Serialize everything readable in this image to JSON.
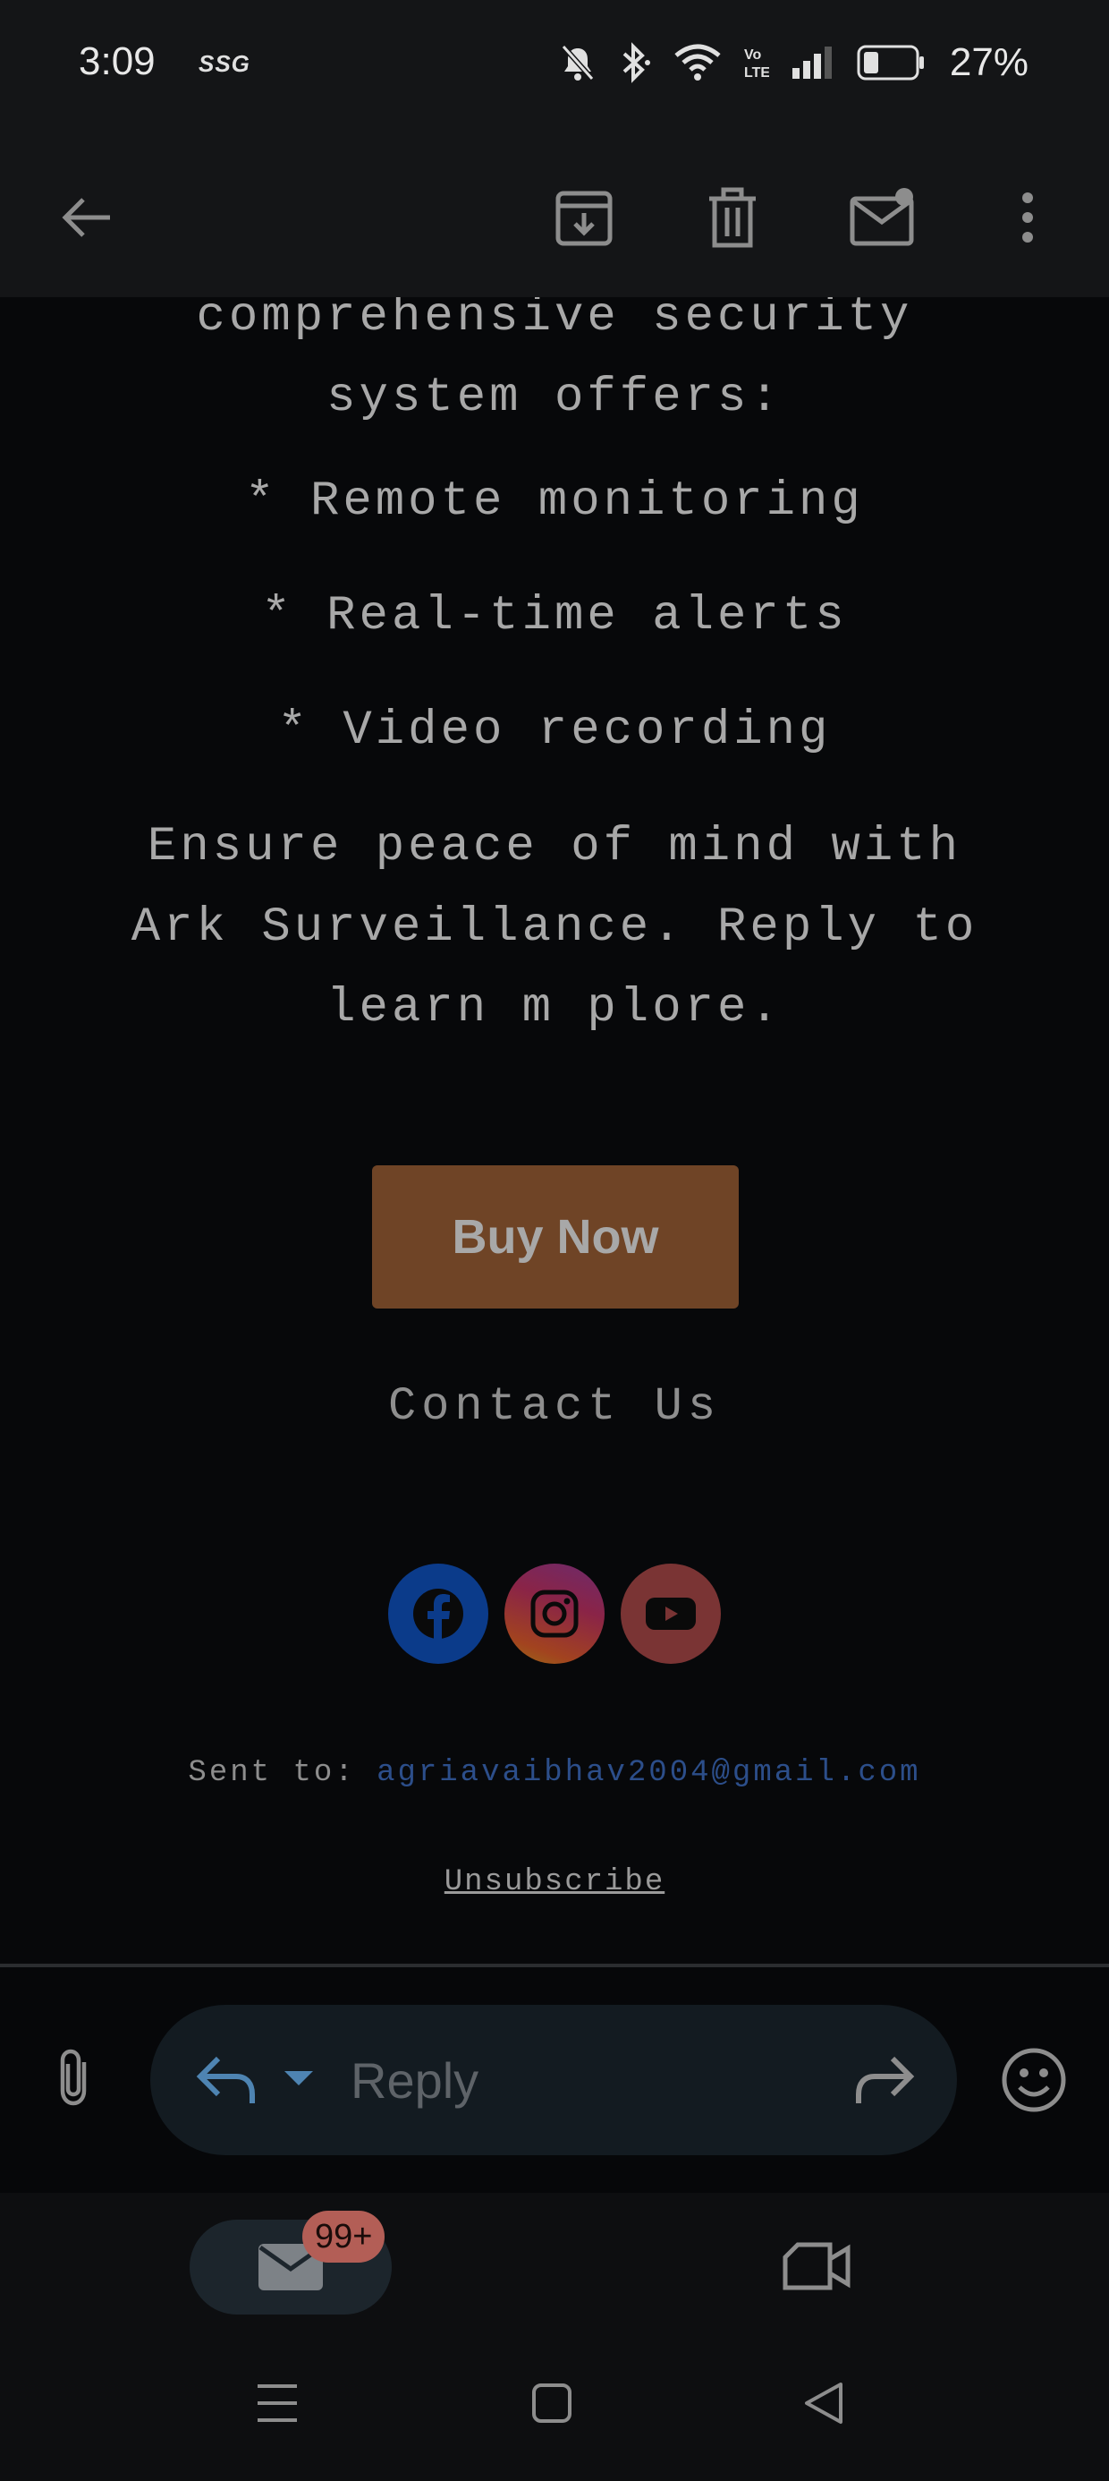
{
  "status_bar": {
    "time": "3:09",
    "carrier": "SSG",
    "battery": "27%"
  },
  "app_bar": {
    "icons": [
      "back-arrow-icon",
      "archive-icon",
      "trash-icon",
      "mark-unread-icon",
      "more-vert-icon"
    ]
  },
  "email": {
    "intro_lines": [
      "comprehensive security",
      "system offers:"
    ],
    "features": [
      "* Remote monitoring",
      "* Real-time alerts",
      "* Video recording"
    ],
    "closing_lines": [
      "Ensure peace of mind with",
      "Ark Surveillance. Reply to",
      "learn m plore."
    ],
    "buy_button": "Buy Now",
    "contact": "Contact Us",
    "social": [
      "facebook-icon",
      "instagram-icon",
      "youtube-icon"
    ],
    "sent_to_label": "Sent to:",
    "sent_to_email": "agriavaibhav2004@gmail.com",
    "unsubscribe": "Unsubscribe"
  },
  "reply_bar": {
    "placeholder": "Reply"
  },
  "bottom_nav": {
    "mail_badge": "99+"
  },
  "colors": {
    "buy_button": "#6f4426",
    "link": "#2c4e8a",
    "badge": "#b35e56"
  }
}
